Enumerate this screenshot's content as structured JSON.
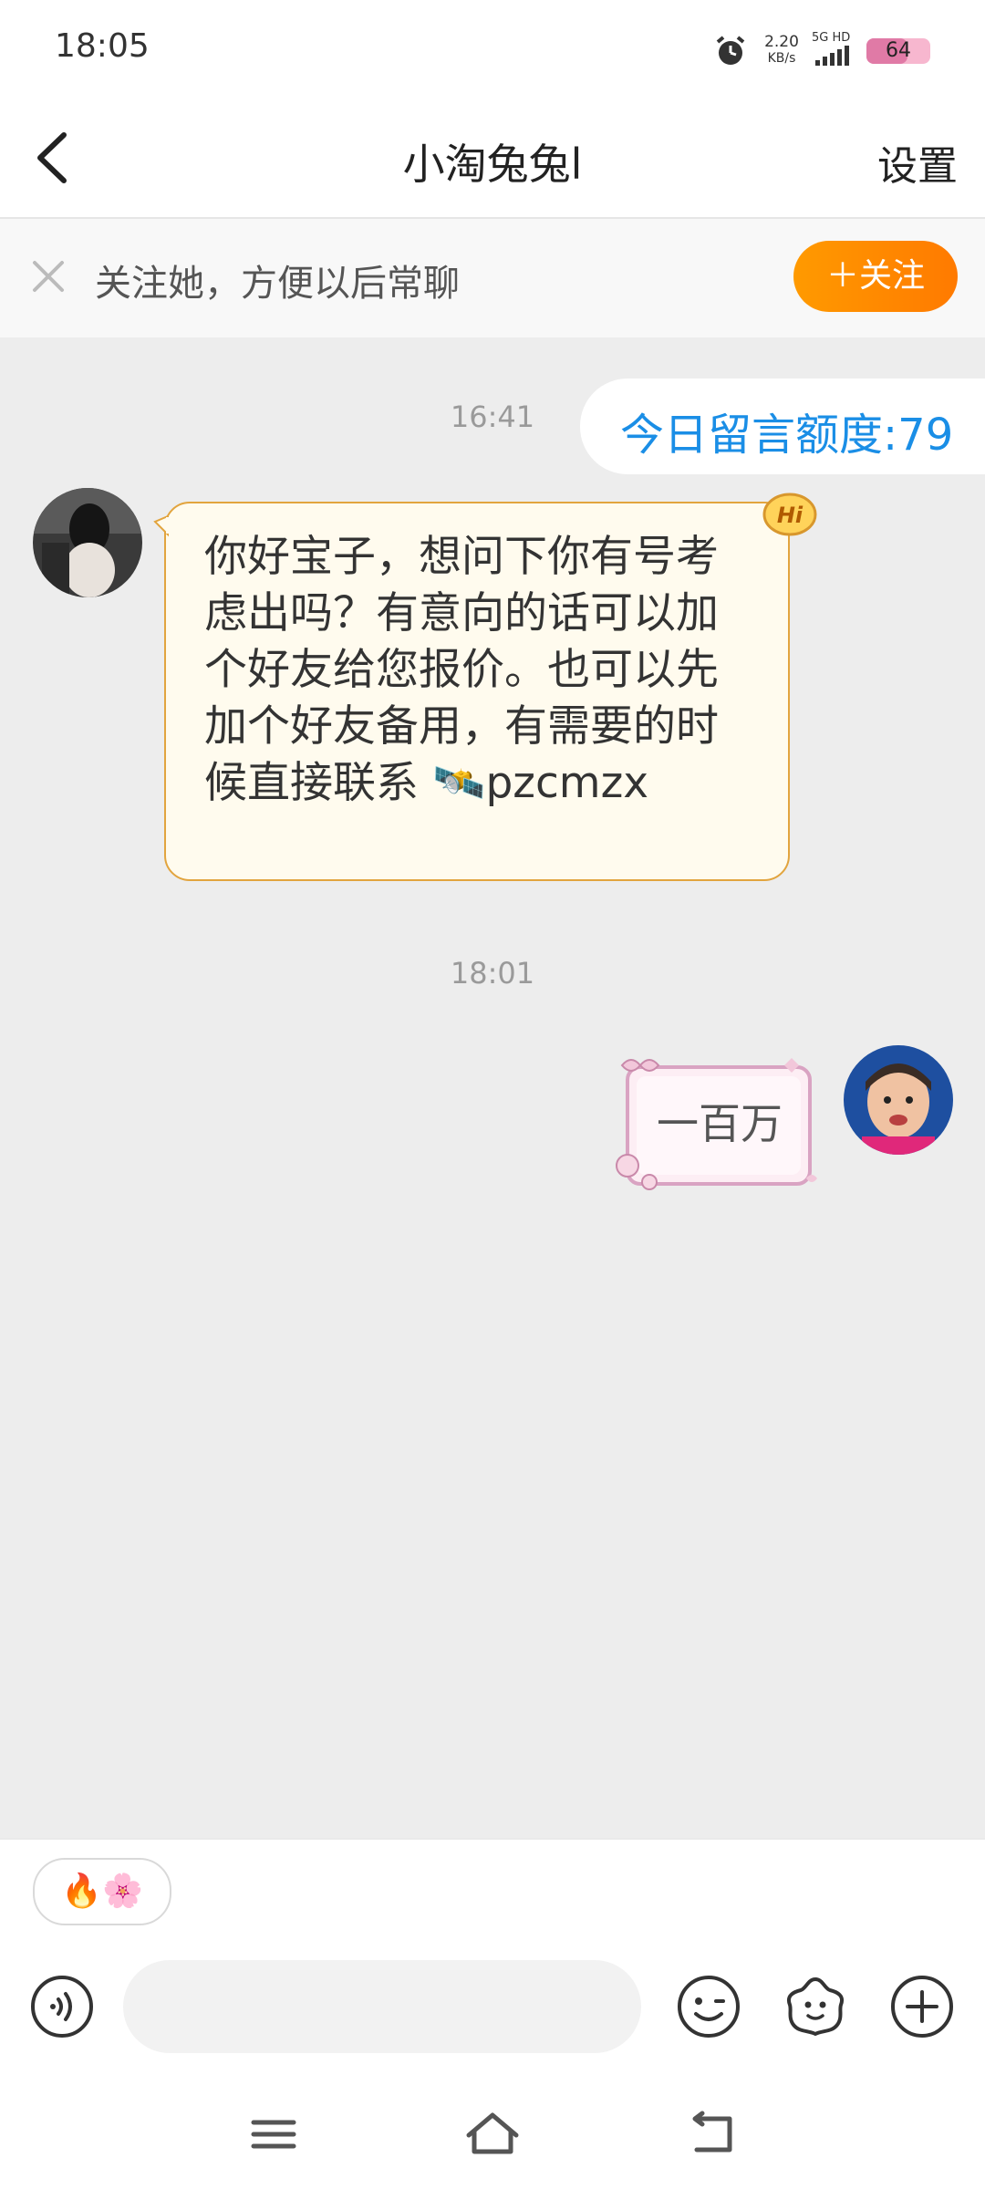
{
  "status_bar": {
    "time": "18:05",
    "net_speed_value": "2.20",
    "net_speed_unit": "KB/s",
    "network": "5G HD",
    "battery": "64",
    "battery_level": 0.64
  },
  "header": {
    "title": "小淘兔兔l",
    "settings_label": "设置"
  },
  "follow_bar": {
    "text": "关注她，方便以后常聊",
    "button_label": "＋关注"
  },
  "chat": {
    "timestamp_1": "16:41",
    "quota_text": "今日留言额度:79",
    "received_message": "你好宝子，想问下你有号考虑出吗？有意向的话可以加个好友给您报价。也可以先加个好友备用，有需要的时候直接联系 🛰️pzcmzx",
    "hi_badge": "Hi",
    "timestamp_2": "18:01",
    "sent_message": "一百万"
  },
  "quick_bar": {
    "emoji_pill": "🔥🌸"
  },
  "input_bar": {
    "placeholder": ""
  },
  "colors": {
    "accent_orange": "#ff8a00",
    "quota_blue": "#1a8ee6",
    "bubble_border": "#e2a43e",
    "bubble_bg": "#fffbee",
    "chat_bg": "#ededed"
  }
}
